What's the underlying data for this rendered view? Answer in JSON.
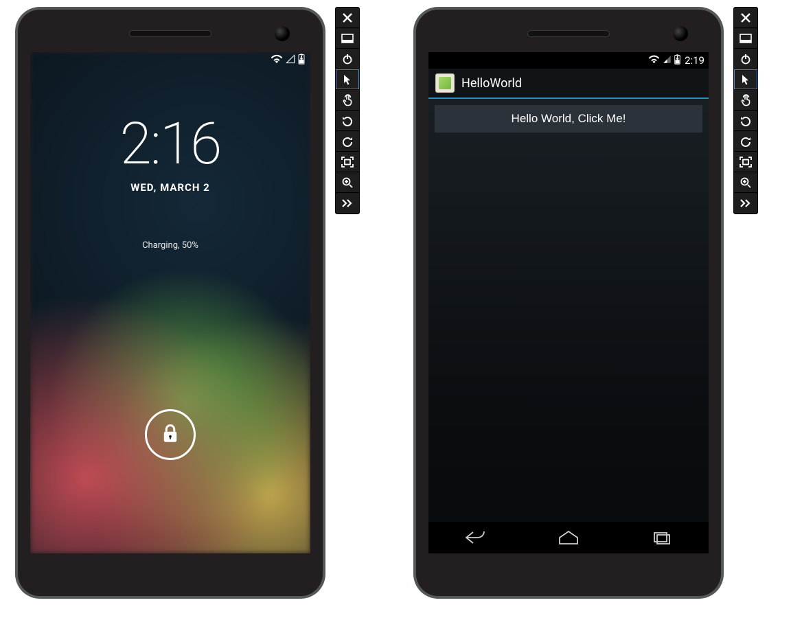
{
  "left": {
    "time": "2:16",
    "date": "WED, MARCH 2",
    "charging": "Charging, 50%"
  },
  "right": {
    "status_time": "2:19",
    "app_title": "HelloWorld",
    "button_label": "Hello World, Click Me!"
  },
  "panel": {
    "items": [
      {
        "name": "close-icon"
      },
      {
        "name": "minimize-icon"
      },
      {
        "name": "power-icon"
      },
      {
        "name": "pointer-icon"
      },
      {
        "name": "touch-icon"
      },
      {
        "name": "rotate-ccw-icon"
      },
      {
        "name": "rotate-cw-icon"
      },
      {
        "name": "fit-screen-icon"
      },
      {
        "name": "zoom-in-icon"
      },
      {
        "name": "more-icon"
      }
    ],
    "selected_index": 3
  }
}
